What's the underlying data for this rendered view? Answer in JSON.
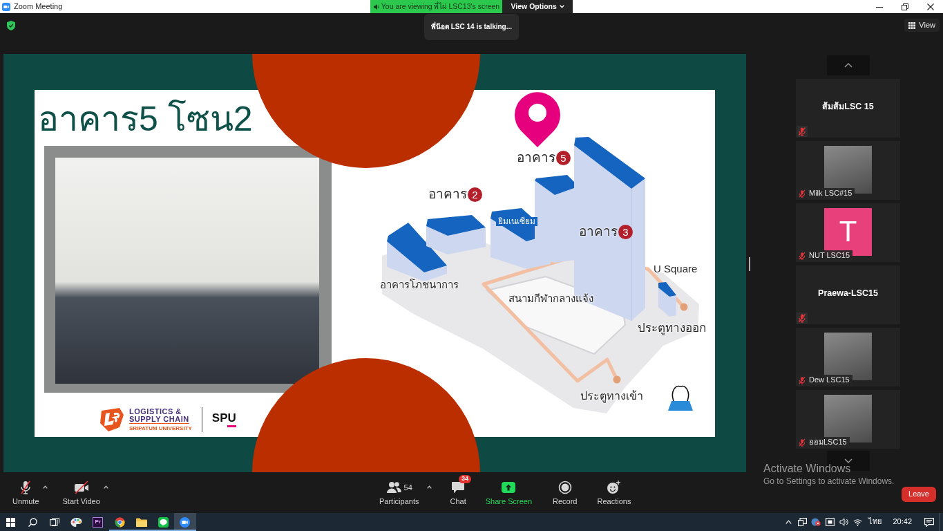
{
  "window": {
    "title": "Zoom Meeting"
  },
  "share_banner": {
    "text": "You are viewing พี่ไผ่ LSC13's screen",
    "options_button": "View Options"
  },
  "talking_indicator": "พี่น๊อต LSC 14 is talking...",
  "view_button": "View",
  "shared_slide": {
    "title": "อาคาร5 โซน2",
    "logo": {
      "line_1": "LOGISTICS &",
      "line_2": "SUPPLY CHAIN",
      "line_3": "SRIPATUM UNIVERSITY",
      "mark": "SPU"
    },
    "map_labels": [
      {
        "kind": "numbered",
        "text": "อาคาร",
        "number": "5"
      },
      {
        "kind": "numbered",
        "text": "อาคาร",
        "number": "2"
      },
      {
        "kind": "roof",
        "text": "ยิมเนเซียม"
      },
      {
        "kind": "numbered",
        "text": "อาคาร",
        "number": "3"
      },
      {
        "kind": "plain",
        "text": "U Square"
      },
      {
        "kind": "plain",
        "text": "อาคารโภชนาการ"
      },
      {
        "kind": "plain",
        "text": "สนามกีฬากลางแจ้ง"
      },
      {
        "kind": "plain",
        "text": "ประตูทางออก"
      },
      {
        "kind": "plain",
        "text": "ประตูทางเข้า"
      }
    ]
  },
  "participants": [
    {
      "name": "ส้มส้มLSC 15",
      "kind": "name",
      "muted": true
    },
    {
      "name": "Milk LSC#15",
      "kind": "photo",
      "muted": true
    },
    {
      "name": "NUT LSC15",
      "kind": "initial",
      "initial": "T",
      "color": "#e8407a",
      "muted": true
    },
    {
      "name": "Praewa-LSC15",
      "kind": "name",
      "muted": true
    },
    {
      "name": "Dew LSC15",
      "kind": "photo",
      "muted": true
    },
    {
      "name": "ออมLSC15",
      "kind": "photo",
      "muted": true
    }
  ],
  "toolbar": {
    "audio": {
      "label": "Unmute",
      "muted": true
    },
    "video": {
      "label": "Start Video",
      "muted": true
    },
    "participants": {
      "label": "Participants",
      "count": "54"
    },
    "chat": {
      "label": "Chat",
      "badge": "34"
    },
    "share": {
      "label": "Share Screen"
    },
    "record": {
      "label": "Record"
    },
    "reactions": {
      "label": "Reactions"
    },
    "leave": "Leave"
  },
  "activation_notice": {
    "title": "Activate Windows",
    "text": "Go to Settings to activate Windows."
  },
  "taskbar": {
    "apps": [
      {
        "kind": "palette",
        "running": false,
        "selected": false
      },
      {
        "kind": "premiere",
        "label": "Pr",
        "running": false,
        "selected": false
      },
      {
        "kind": "browser",
        "running": true,
        "selected": false
      },
      {
        "kind": "folder",
        "running": true,
        "selected": false
      },
      {
        "kind": "messenger",
        "running": true,
        "selected": false
      },
      {
        "kind": "meeting",
        "running": true,
        "selected": true
      }
    ],
    "language": "ไทย",
    "time": "20:42"
  }
}
